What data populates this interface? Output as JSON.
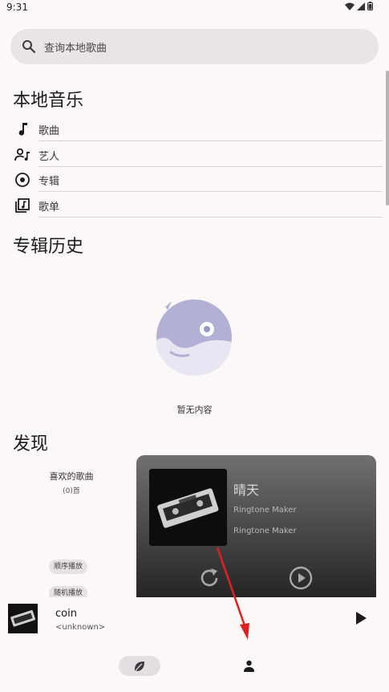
{
  "status_bar": {
    "time": "9:31"
  },
  "search": {
    "placeholder": "查询本地歌曲"
  },
  "local_music": {
    "title": "本地音乐",
    "items": [
      {
        "label": "歌曲",
        "icon": "music-note-icon"
      },
      {
        "label": "艺人",
        "icon": "artist-icon"
      },
      {
        "label": "专辑",
        "icon": "album-icon"
      },
      {
        "label": "歌单",
        "icon": "playlist-icon"
      }
    ]
  },
  "album_history": {
    "title": "专辑历史",
    "empty_text": "暂无内容"
  },
  "discover": {
    "title": "发现",
    "favorites": {
      "title": "喜欢的歌曲",
      "count": "(0)首"
    },
    "chips": [
      "顺序播放",
      "随机播放"
    ],
    "card": {
      "title": "晴天",
      "line1": "Ringtone Maker",
      "line2": "Ringtone Maker"
    }
  },
  "player": {
    "title": "coin",
    "artist": "<unknown>"
  },
  "colors": {
    "background": "#fbf8f7",
    "search_bg": "#e9e5e4",
    "whale": "#b3b0d6",
    "arrow": "#e02020"
  }
}
